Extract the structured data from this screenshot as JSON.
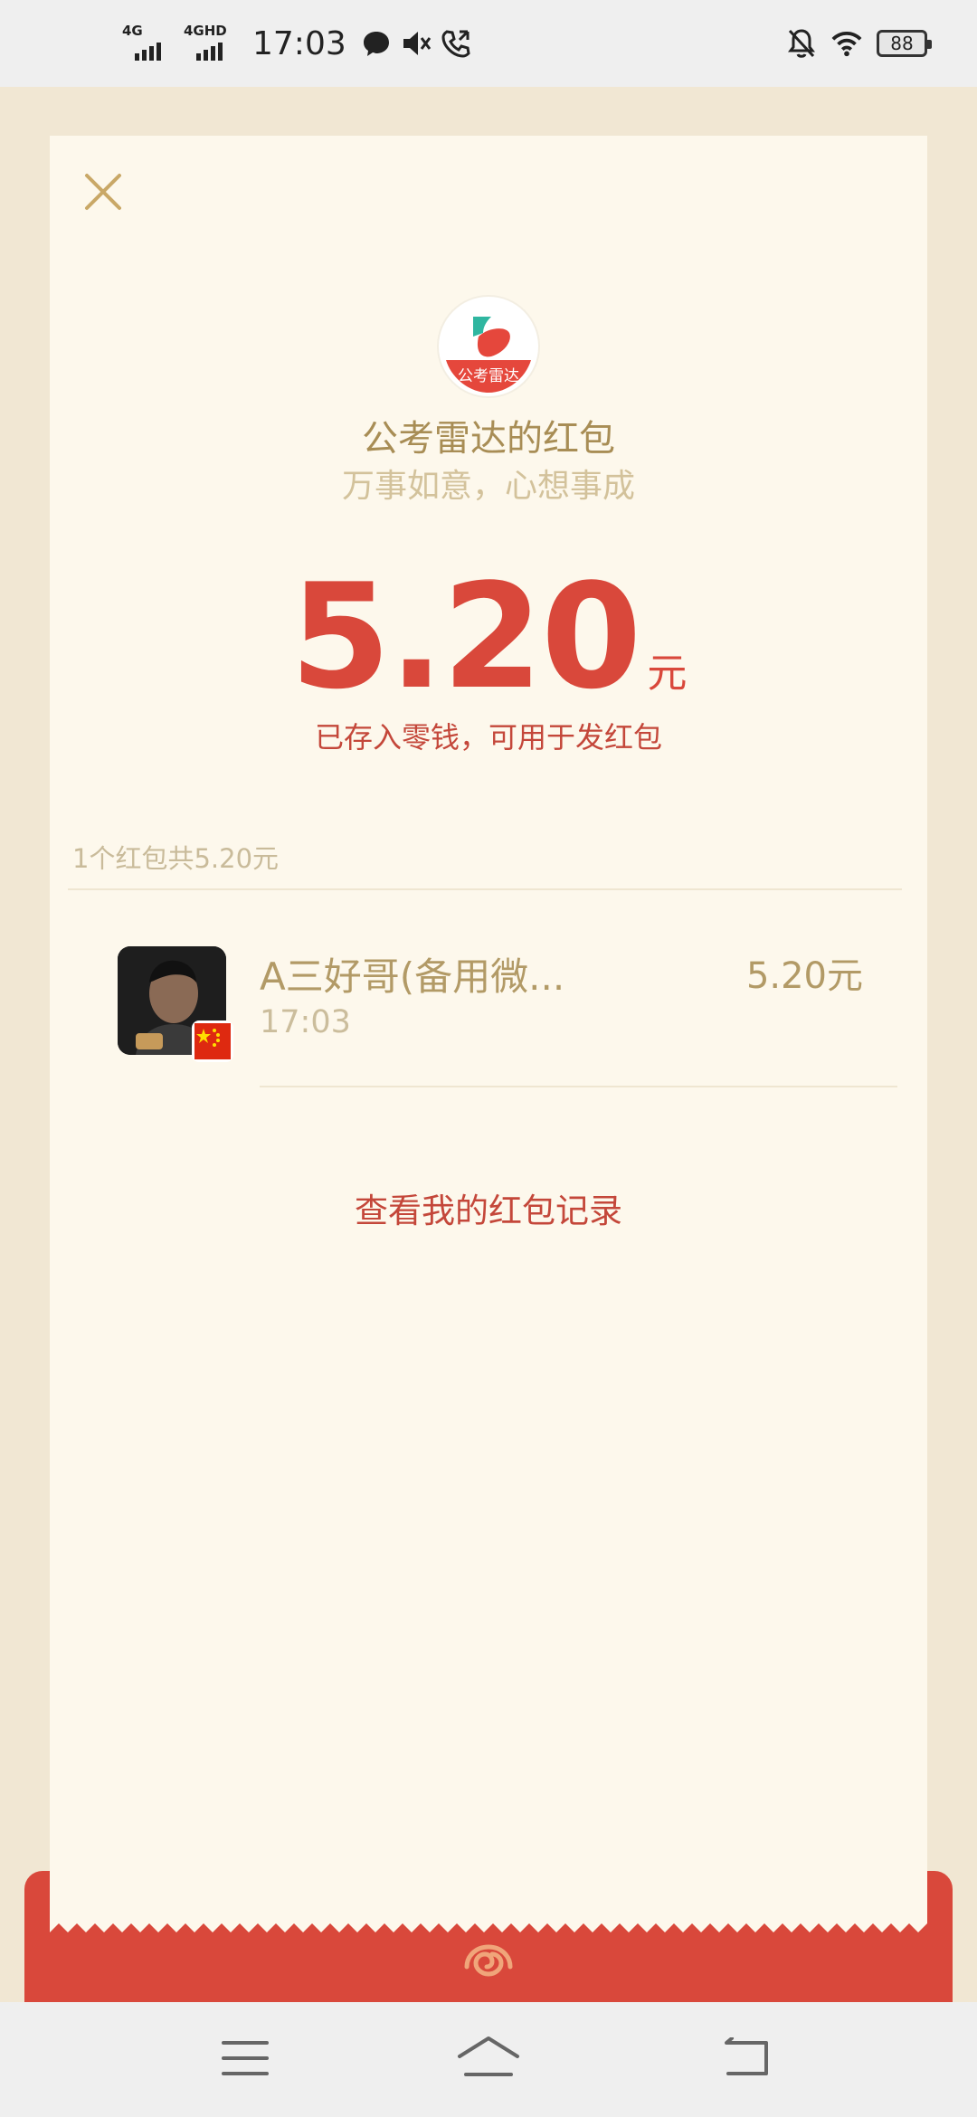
{
  "status_bar": {
    "net1_label": "4G",
    "net2_label": "4GHD",
    "time": "17:03",
    "battery": "88"
  },
  "packet": {
    "sender_title": "公考雷达的红包",
    "app_logo_text": "公考雷达",
    "greeting": "万事如意，心想事成",
    "amount": "5.20",
    "amount_unit": "元",
    "deposit_note": "已存入零钱，可用于发红包",
    "summary": "1个红包共5.20元"
  },
  "receivers": [
    {
      "name": "A三好哥(备用微...",
      "time": "17:03",
      "amount": "5.20元"
    }
  ],
  "records_link": "查看我的红包记录",
  "colors": {
    "accent_red": "#d9483b",
    "gold": "#b29a66",
    "card_bg": "#fdf8ec",
    "page_bg": "#f1e7d3"
  }
}
